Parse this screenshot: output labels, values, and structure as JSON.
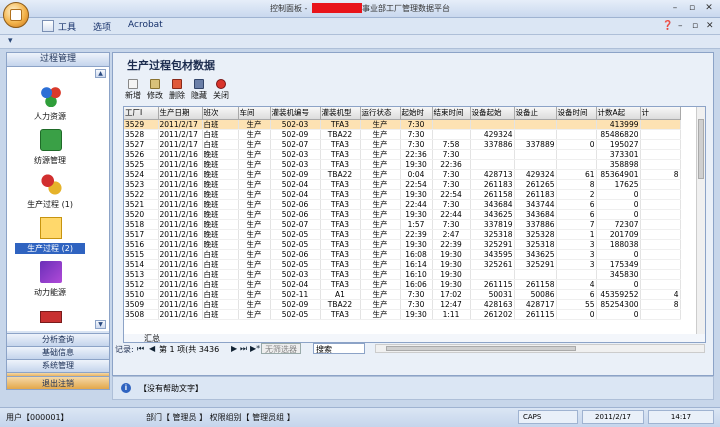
{
  "window": {
    "title_prefix": "控制面板 -",
    "title_suffix": "事业部工厂管理数据平台",
    "minimize": "–",
    "restore": "▫",
    "close": "✕"
  },
  "menu": {
    "items": [
      "工具",
      "选项",
      "Acrobat"
    ],
    "help": "❓",
    "min": "–",
    "restore": "▫",
    "close": "✕"
  },
  "ribbon_toggle": "▾",
  "sidebar": {
    "header": "过程管理",
    "items": [
      {
        "label": "人力资源",
        "icon": "people-icon"
      },
      {
        "label": "纺源管理",
        "icon": "dice-icon"
      },
      {
        "label": "生产过程 (1)",
        "icon": "gears-icon"
      },
      {
        "label": "生产过程 (2)",
        "icon": "grid-icon"
      },
      {
        "label": "动力能源",
        "icon": "chart-icon"
      }
    ],
    "groups": [
      "分析查询",
      "基础信息",
      "系统管理",
      "退出注销"
    ]
  },
  "content": {
    "title": "生产过程包材数据",
    "toolbar": [
      {
        "label": "新增",
        "color": "#e8e8e8"
      },
      {
        "label": "修改",
        "color": "#d9c27a"
      },
      {
        "label": "删除",
        "color": "#e05a3a"
      },
      {
        "label": "隐藏",
        "color": "#6b7fa8"
      },
      {
        "label": "关闭",
        "color": "#d9342b"
      }
    ]
  },
  "grid": {
    "columns": [
      "工厂I",
      "生产日期",
      "班次",
      "车间",
      "灌装机编号",
      "灌装机型",
      "运行状态",
      "起始时",
      "结束时间",
      "设备起始",
      "设备止",
      "设备时间",
      "计数A起",
      "计"
    ],
    "rows": [
      [
        "3529",
        "2011/2/17",
        "白班",
        "生产",
        "502-03",
        "TFA3",
        "生产",
        "7:30",
        "",
        "",
        "",
        "",
        "413999",
        ""
      ],
      [
        "3528",
        "2011/2/17",
        "白班",
        "生产",
        "502-09",
        "TBA22",
        "生产",
        "7:30",
        "",
        "429324",
        "",
        "",
        "85486820",
        ""
      ],
      [
        "3527",
        "2011/2/17",
        "白班",
        "生产",
        "502-07",
        "TFA3",
        "生产",
        "7:30",
        "7:58",
        "337886",
        "337889",
        "0",
        "195027",
        ""
      ],
      [
        "3526",
        "2011/2/16",
        "晚班",
        "生产",
        "502-03",
        "TFA3",
        "生产",
        "22:36",
        "7:30",
        "",
        "",
        "",
        "373301",
        ""
      ],
      [
        "3525",
        "2011/2/16",
        "晚班",
        "生产",
        "502-03",
        "TFA3",
        "生产",
        "19:30",
        "22:36",
        "",
        "",
        "",
        "358898",
        ""
      ],
      [
        "3524",
        "2011/2/16",
        "晚班",
        "生产",
        "502-09",
        "TBA22",
        "生产",
        "0:04",
        "7:30",
        "428713",
        "429324",
        "61",
        "85364901",
        "8"
      ],
      [
        "3523",
        "2011/2/16",
        "晚班",
        "生产",
        "502-04",
        "TFA3",
        "生产",
        "22:54",
        "7:30",
        "261183",
        "261265",
        "8",
        "17625",
        ""
      ],
      [
        "3522",
        "2011/2/16",
        "晚班",
        "生产",
        "502-04",
        "TFA3",
        "生产",
        "19:30",
        "22:54",
        "261158",
        "261183",
        "2",
        "0",
        ""
      ],
      [
        "3521",
        "2011/2/16",
        "晚班",
        "生产",
        "502-06",
        "TFA3",
        "生产",
        "22:44",
        "7:30",
        "343684",
        "343744",
        "6",
        "0",
        ""
      ],
      [
        "3520",
        "2011/2/16",
        "晚班",
        "生产",
        "502-06",
        "TFA3",
        "生产",
        "19:30",
        "22:44",
        "343625",
        "343684",
        "6",
        "0",
        ""
      ],
      [
        "3518",
        "2011/2/16",
        "晚班",
        "生产",
        "502-07",
        "TFA3",
        "生产",
        "1:57",
        "7:30",
        "337819",
        "337886",
        "7",
        "72307",
        ""
      ],
      [
        "3517",
        "2011/2/16",
        "晚班",
        "生产",
        "502-05",
        "TFA3",
        "生产",
        "22:39",
        "2:47",
        "325318",
        "325328",
        "1",
        "201709",
        ""
      ],
      [
        "3516",
        "2011/2/16",
        "晚班",
        "生产",
        "502-05",
        "TFA3",
        "生产",
        "19:30",
        "22:39",
        "325291",
        "325318",
        "3",
        "188038",
        ""
      ],
      [
        "3515",
        "2011/2/16",
        "白班",
        "生产",
        "502-06",
        "TFA3",
        "生产",
        "16:08",
        "19:30",
        "343595",
        "343625",
        "3",
        "0",
        ""
      ],
      [
        "3514",
        "2011/2/16",
        "白班",
        "生产",
        "502-05",
        "TFA3",
        "生产",
        "16:14",
        "19:30",
        "325261",
        "325291",
        "3",
        "175349",
        ""
      ],
      [
        "3513",
        "2011/2/16",
        "白班",
        "生产",
        "502-03",
        "TFA3",
        "生产",
        "16:10",
        "19:30",
        "",
        "",
        "",
        "345830",
        ""
      ],
      [
        "3512",
        "2011/2/16",
        "白班",
        "生产",
        "502-04",
        "TFA3",
        "生产",
        "16:06",
        "19:30",
        "261115",
        "261158",
        "4",
        "0",
        ""
      ],
      [
        "3510",
        "2011/2/16",
        "白班",
        "生产",
        "502-11",
        "A1",
        "生产",
        "7:30",
        "17:02",
        "50031",
        "50086",
        "6",
        "45359252",
        "4"
      ],
      [
        "3509",
        "2011/2/16",
        "白班",
        "生产",
        "502-09",
        "TBA22",
        "生产",
        "7:30",
        "12:47",
        "428163",
        "428717",
        "55",
        "85254300",
        "8"
      ],
      [
        "3508",
        "2011/2/16",
        "白班",
        "生产",
        "502-05",
        "TFA3",
        "生产",
        "19:30",
        "1:11",
        "261202",
        "261115",
        "0",
        "0",
        ""
      ]
    ],
    "summary": "汇总"
  },
  "navbar": {
    "label": "记录:",
    "first": "⏮",
    "prev": "◀",
    "record": "第 1 项(共 3436",
    "next": "▶",
    "last": "⏭",
    "new": "▶*",
    "nofilter": "无筛选器",
    "search": "搜索"
  },
  "help": {
    "icon": "i",
    "text": "【没有帮助文字】"
  },
  "status": {
    "user": "用户【000001】",
    "dept": "部门【 管理员 】 权限组别【 管理员组 】",
    "caps": "CAPS",
    "date": "2011/2/17",
    "time": "14:17"
  }
}
